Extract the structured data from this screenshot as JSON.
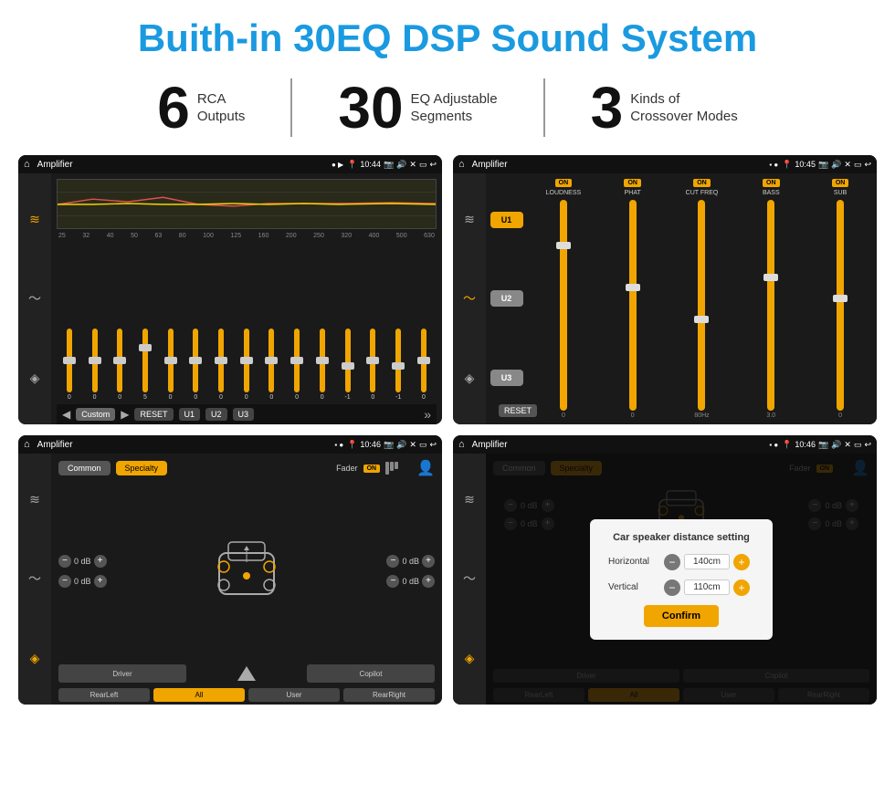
{
  "page": {
    "title": "Buith-in 30EQ DSP Sound System",
    "stats": [
      {
        "number": "6",
        "text_line1": "RCA",
        "text_line2": "Outputs"
      },
      {
        "number": "30",
        "text_line1": "EQ Adjustable",
        "text_line2": "Segments"
      },
      {
        "number": "3",
        "text_line1": "Kinds of",
        "text_line2": "Crossover Modes"
      }
    ]
  },
  "screen1": {
    "title": "Amplifier",
    "time": "10:44",
    "freq_labels": [
      "25",
      "32",
      "40",
      "50",
      "63",
      "80",
      "100",
      "125",
      "160",
      "200",
      "250",
      "320",
      "400",
      "500",
      "630"
    ],
    "slider_values": [
      "0",
      "0",
      "0",
      "5",
      "0",
      "0",
      "0",
      "0",
      "0",
      "0",
      "0",
      "-1",
      "0",
      "-1"
    ],
    "bottom_buttons": [
      "Custom",
      "RESET",
      "U1",
      "U2",
      "U3"
    ]
  },
  "screen2": {
    "title": "Amplifier",
    "time": "10:45",
    "u_buttons": [
      "U1",
      "U2",
      "U3"
    ],
    "channels": [
      {
        "label": "LOUDNESS",
        "on": true
      },
      {
        "label": "PHAT",
        "on": true
      },
      {
        "label": "CUT FREQ",
        "on": true
      },
      {
        "label": "BASS",
        "on": true
      },
      {
        "label": "SUB",
        "on": true
      }
    ],
    "reset_label": "RESET"
  },
  "screen3": {
    "title": "Amplifier",
    "time": "10:46",
    "tabs": [
      "Common",
      "Specialty"
    ],
    "fader_label": "Fader",
    "on_label": "ON",
    "db_controls": [
      {
        "value": "0 dB"
      },
      {
        "value": "0 dB"
      },
      {
        "value": "0 dB"
      },
      {
        "value": "0 dB"
      }
    ],
    "bottom_buttons": [
      "Driver",
      "",
      "",
      "Copilot",
      "RearLeft",
      "All",
      "User",
      "RearRight"
    ]
  },
  "screen4": {
    "title": "Amplifier",
    "time": "10:46",
    "tabs": [
      "Common",
      "Specialty"
    ],
    "dialog": {
      "title": "Car speaker distance setting",
      "horizontal_label": "Horizontal",
      "horizontal_value": "140cm",
      "vertical_label": "Vertical",
      "vertical_value": "110cm",
      "confirm_label": "Confirm"
    },
    "db_controls": [
      {
        "value": "0 dB"
      },
      {
        "value": "0 dB"
      }
    ],
    "bottom_buttons": [
      "Driver",
      "Copilot",
      "RearLeft",
      "All",
      "User",
      "RearRight"
    ]
  },
  "icons": {
    "home": "⌂",
    "settings": "≡",
    "back": "↩",
    "location": "📍",
    "volume": "🔊",
    "close_x": "✕",
    "window": "▭",
    "eq_icon": "≋",
    "wave_icon": "〜",
    "speaker_icon": "◈"
  }
}
